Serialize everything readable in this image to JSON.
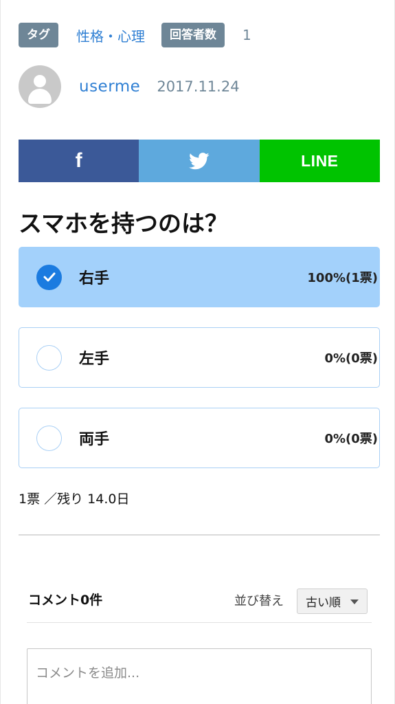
{
  "meta": {
    "tag_badge": "タグ",
    "tag_link": "性格・心理",
    "respondents_badge": "回答者数",
    "respondents_count": "1"
  },
  "author": {
    "username": "userme",
    "date": "2017.11.24"
  },
  "share": {
    "facebook_label": "f",
    "line_label": "LINE",
    "colors": {
      "facebook": "#3b5998",
      "twitter": "#5ea9dd",
      "line": "#00c300"
    }
  },
  "poll": {
    "question": "スマホを持つのは？",
    "options": [
      {
        "label": "右手",
        "result": "100%(1票)",
        "selected": true
      },
      {
        "label": "左手",
        "result": "0%(0票)",
        "selected": false
      },
      {
        "label": "両手",
        "result": "0%(0票)",
        "selected": false
      }
    ],
    "summary": "1票 ／残り 14.0日"
  },
  "comments": {
    "title": "コメント0件",
    "sort_label": "並び替え",
    "sort_value": "古い順",
    "placeholder": "コメントを追加..."
  }
}
